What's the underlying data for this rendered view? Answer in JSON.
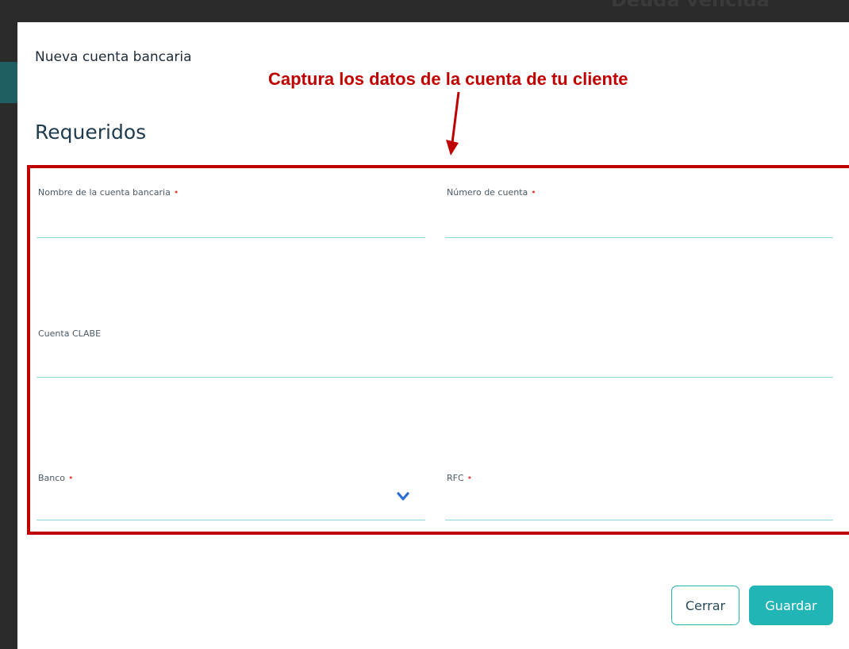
{
  "background": {
    "title_fragment": "Deuda vencida"
  },
  "modal": {
    "title": "Nueva cuenta bancaria",
    "section_title": "Requeridos"
  },
  "annotation": {
    "text": "Captura los datos de la cuenta de tu cliente",
    "color": "#c00000"
  },
  "fields": {
    "nombre": {
      "label": "Nombre de la cuenta bancaria",
      "value": "",
      "required": "•"
    },
    "numero": {
      "label": "Número de cuenta",
      "value": "",
      "required": "•"
    },
    "clabe": {
      "label": "Cuenta CLABE",
      "value": ""
    },
    "banco": {
      "label": "Banco",
      "value": "",
      "required": "•",
      "icon": "chevron-down-icon"
    },
    "rfc": {
      "label": "RFC",
      "value": "",
      "required": "•"
    }
  },
  "buttons": {
    "close_label": "Cerrar",
    "save_label": "Guardar"
  },
  "colors": {
    "accent": "#22b5b5",
    "required_marker": "#e8423c",
    "chevron": "#2a6fd6"
  }
}
